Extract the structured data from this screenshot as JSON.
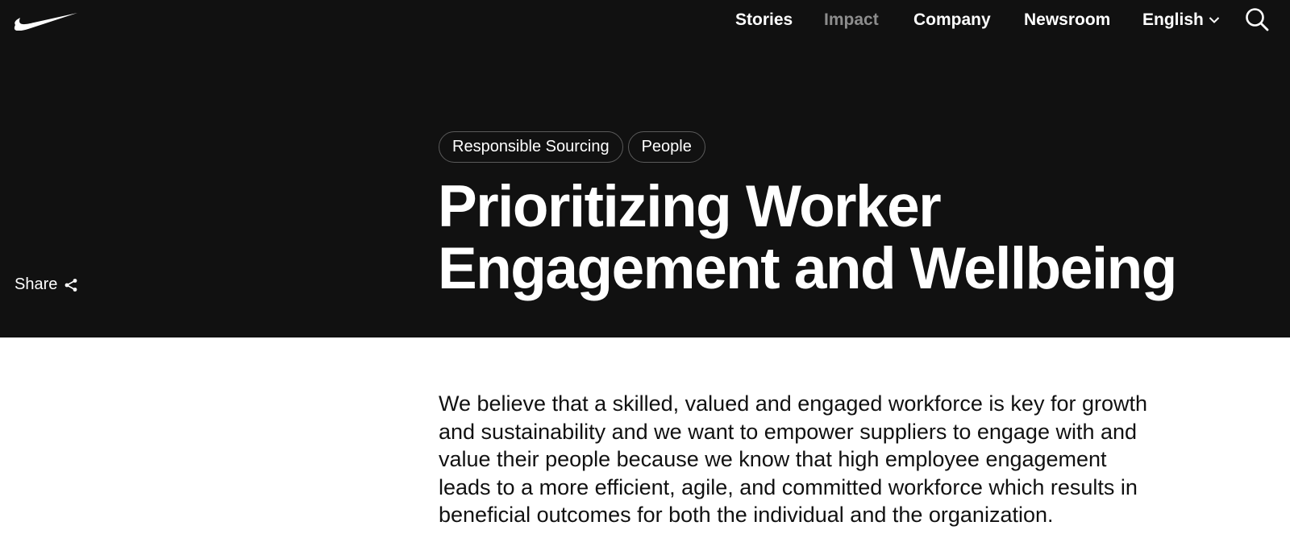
{
  "brand": {
    "logo_icon": "nike-swoosh-icon"
  },
  "nav": {
    "items": [
      {
        "label": "Stories",
        "active": false
      },
      {
        "label": "Impact",
        "active": true
      },
      {
        "label": "Company",
        "active": false
      },
      {
        "label": "Newsroom",
        "active": false
      }
    ],
    "language": "English",
    "language_icon": "chevron-down-icon",
    "search_icon": "search-icon"
  },
  "hero": {
    "tags": [
      "Responsible Sourcing",
      "People"
    ],
    "title": "Prioritizing Worker Engagement and Wellbeing",
    "share_label": "Share",
    "share_icon": "share-icon"
  },
  "article": {
    "intro": "We believe that a skilled, valued and engaged workforce is key for growth and sustainability and we want to empower suppliers to engage with and value their people because we know that high employee engagement leads to a more efficient, agile, and committed workforce which results in beneficial outcomes for both the individual and the organization."
  },
  "colors": {
    "hero_bg": "#111111",
    "nav_dim": "#8d8d8d",
    "text_light": "#ffffff",
    "text_dark": "#111111"
  }
}
